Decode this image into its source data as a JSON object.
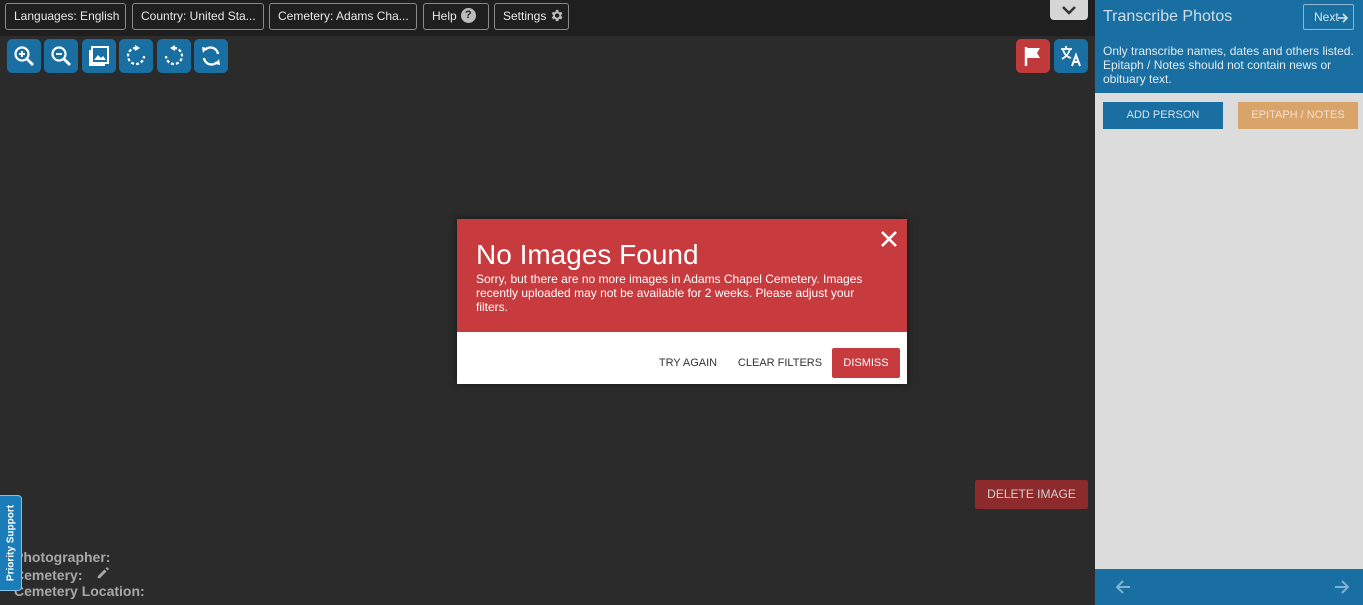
{
  "toolbar": {
    "languages_label": "Languages: English",
    "country_label": "Country: United Sta...",
    "cemetery_label": "Cemetery: Adams Cha...",
    "help_label": "Help",
    "help_icon_glyph": "?",
    "settings_label": "Settings"
  },
  "tools": [
    "zoom-in-icon",
    "zoom-out-icon",
    "image-icon",
    "rotate-right-icon",
    "rotate-left-icon",
    "refresh-icon",
    "flag-icon",
    "translate-icon"
  ],
  "modal": {
    "title": "No Images Found",
    "message": "Sorry, but there are no more images in Adams Chapel Cemetery. Images recently uploaded may not be available for 2 weeks. Please adjust your filters.",
    "try_again": "TRY AGAIN",
    "clear_filters": "CLEAR FILTERS",
    "dismiss": "DISMISS"
  },
  "main": {
    "delete_image": "DELETE IMAGE",
    "photographer_label": "Photographer:",
    "cemetery_label": "Cemetery:",
    "cemetery_location_label": "Cemetery Location:",
    "priority_support": "Priority Support"
  },
  "sidebar": {
    "title": "Transcribe Photos",
    "next_label": "Next",
    "instructions": "Only transcribe names, dates and others listed. Epitaph / Notes should not contain news or obituary text.",
    "add_person": "ADD PERSON",
    "epitaph_notes": "EPITAPH / NOTES"
  },
  "colors": {
    "primary_blue": "#1a6fa2",
    "danger_red": "#c73a3d",
    "epitaph_orange": "#d9a46a"
  }
}
